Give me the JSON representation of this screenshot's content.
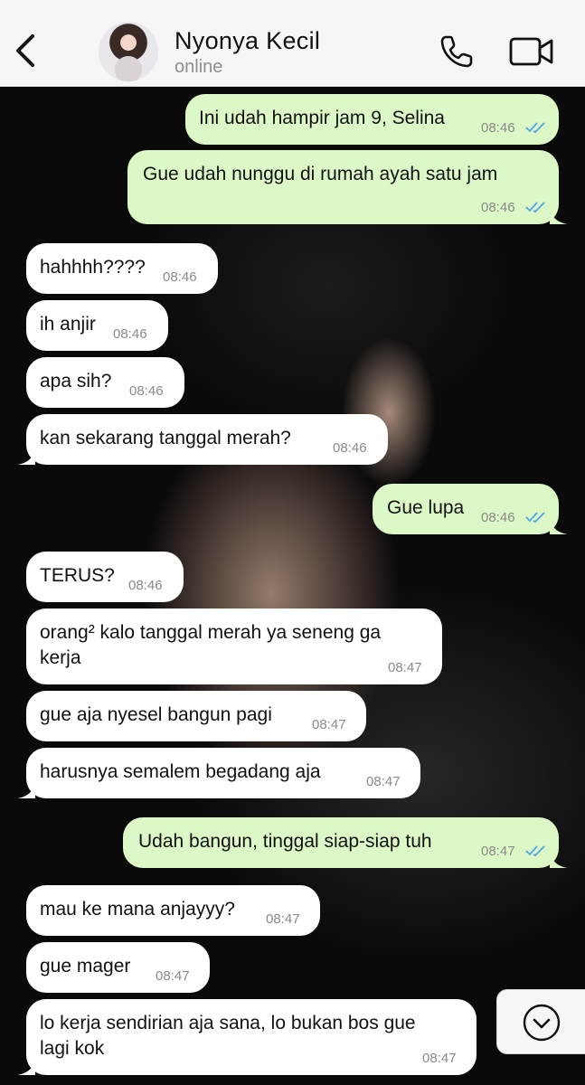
{
  "header": {
    "contact_name": "Nyonya Kecil",
    "status": "online"
  },
  "colors": {
    "outgoing_bubble": "#dcf8c6",
    "incoming_bubble": "#ffffff",
    "read_ticks": "#4fa3e8",
    "header_bg": "#f6f6f6"
  },
  "messages": [
    {
      "dir": "out",
      "text": "Ini udah hampir jam 9, Selina",
      "time": "08:46",
      "read": true
    },
    {
      "dir": "out",
      "text": "Gue udah nunggu di rumah ayah satu jam",
      "time": "08:46",
      "read": true
    },
    {
      "dir": "in",
      "text": "hahhhh????",
      "time": "08:46"
    },
    {
      "dir": "in",
      "text": "ih anjir",
      "time": "08:46"
    },
    {
      "dir": "in",
      "text": "apa sih?",
      "time": "08:46"
    },
    {
      "dir": "in",
      "text": "kan sekarang tanggal merah?",
      "time": "08:46"
    },
    {
      "dir": "out",
      "text": "Gue lupa",
      "time": "08:46",
      "read": true
    },
    {
      "dir": "in",
      "text": "TERUS?",
      "time": "08:46"
    },
    {
      "dir": "in",
      "text_line1": "orang² kalo tanggal merah ya seneng ga",
      "text_line2": "kerja",
      "time": "08:47"
    },
    {
      "dir": "in",
      "text": "gue aja nyesel bangun pagi",
      "time": "08:47"
    },
    {
      "dir": "in",
      "text": "harusnya semalem begadang aja",
      "time": "08:47"
    },
    {
      "dir": "out",
      "text": "Udah bangun, tinggal siap-siap tuh",
      "time": "08:47",
      "read": true
    },
    {
      "dir": "in",
      "text": "mau ke mana anjayyy?",
      "time": "08:47"
    },
    {
      "dir": "in",
      "text": "gue mager",
      "time": "08:47"
    },
    {
      "dir": "in",
      "text_line1": "lo kerja sendirian aja sana, lo bukan bos gue",
      "text_line2": "lagi kok",
      "time": "08:47"
    }
  ]
}
